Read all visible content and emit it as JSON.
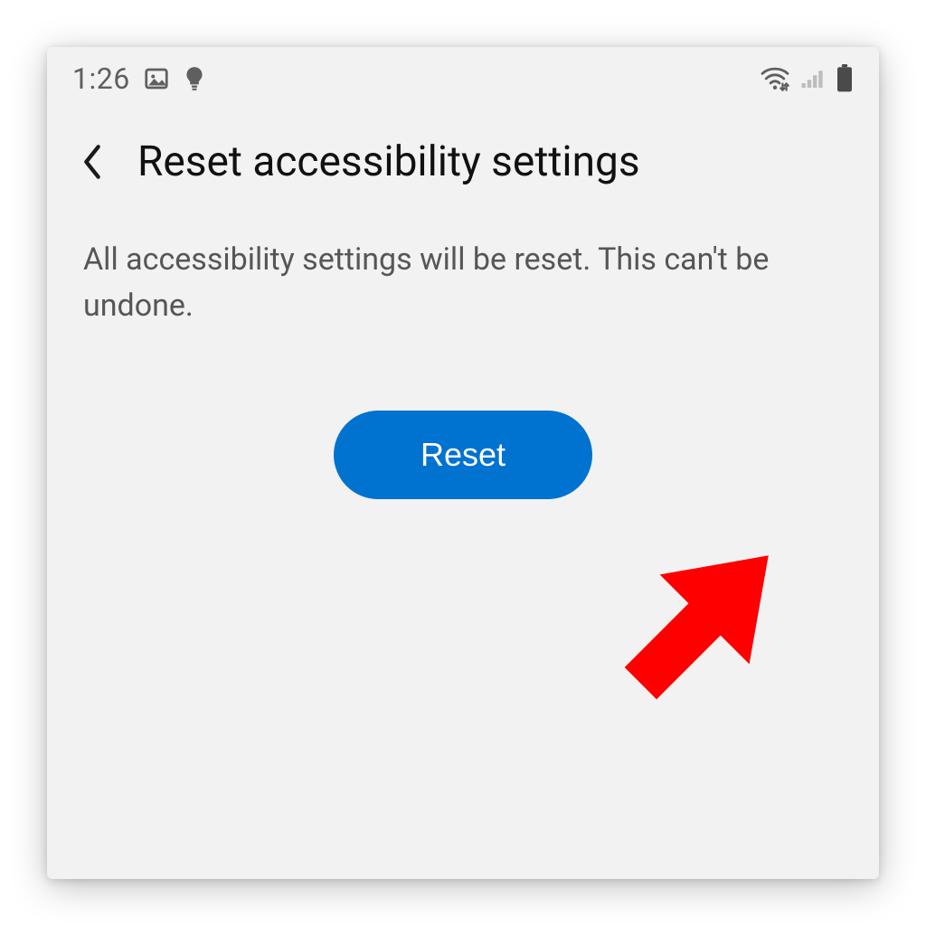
{
  "status_bar": {
    "time": "1:26",
    "icons_left": {
      "picture": "picture-icon",
      "bulb": "bulb-icon"
    },
    "icons_right": {
      "wifi": "wifi-icon",
      "signal": "signal-icon",
      "battery": "battery-icon"
    }
  },
  "header": {
    "title": "Reset accessibility settings"
  },
  "body": {
    "description": "All accessibility settings will be reset. This can't be undone."
  },
  "actions": {
    "reset_label": "Reset"
  },
  "colors": {
    "accent": "#0072cf",
    "background": "#f2f2f2",
    "annotation": "#ff0000"
  }
}
